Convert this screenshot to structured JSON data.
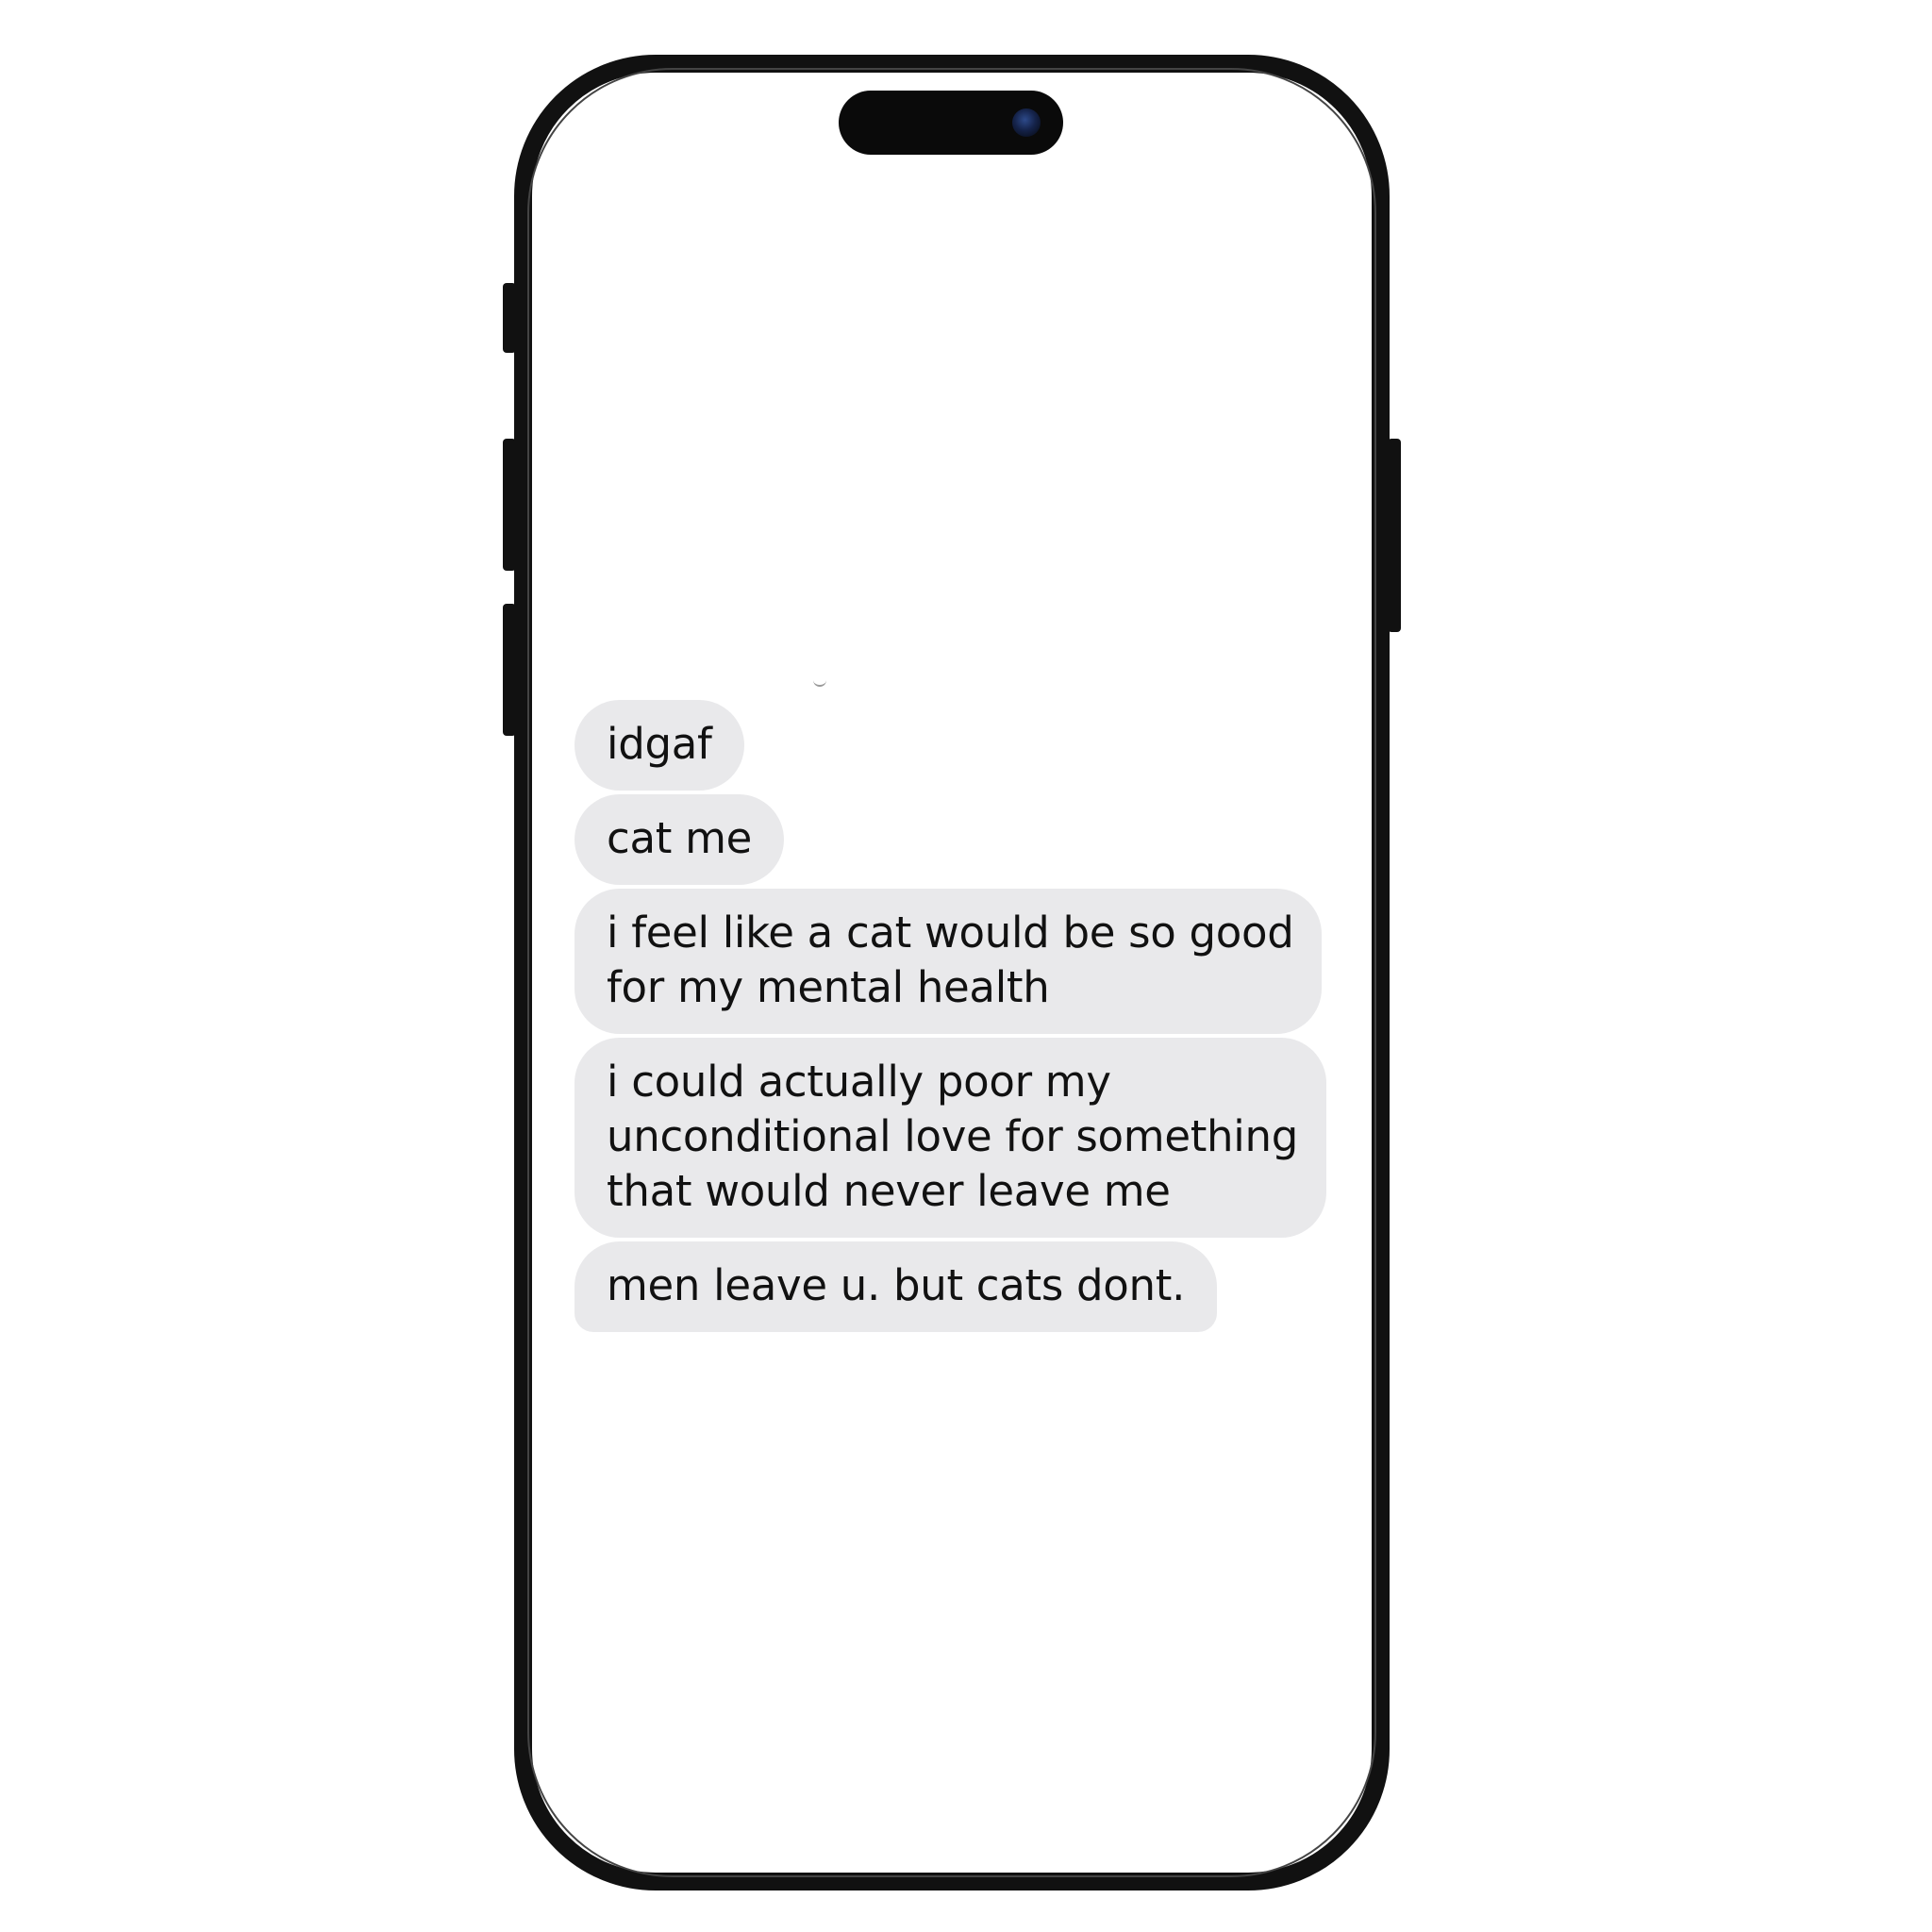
{
  "conversation": {
    "messages": [
      {
        "text": "idgaf"
      },
      {
        "text": "cat me"
      },
      {
        "lines": [
          "i feel like a cat would be so good",
          "for my mental health"
        ]
      },
      {
        "lines": [
          "i could actually poor my",
          "unconditional love for something",
          "that would never leave me"
        ]
      },
      {
        "text": "men leave u. but cats dont."
      }
    ],
    "bubble_color": "#e9e9eb",
    "text_color": "#111111"
  },
  "device": {
    "frame_color": "#111111",
    "screen_color": "#ffffff"
  }
}
